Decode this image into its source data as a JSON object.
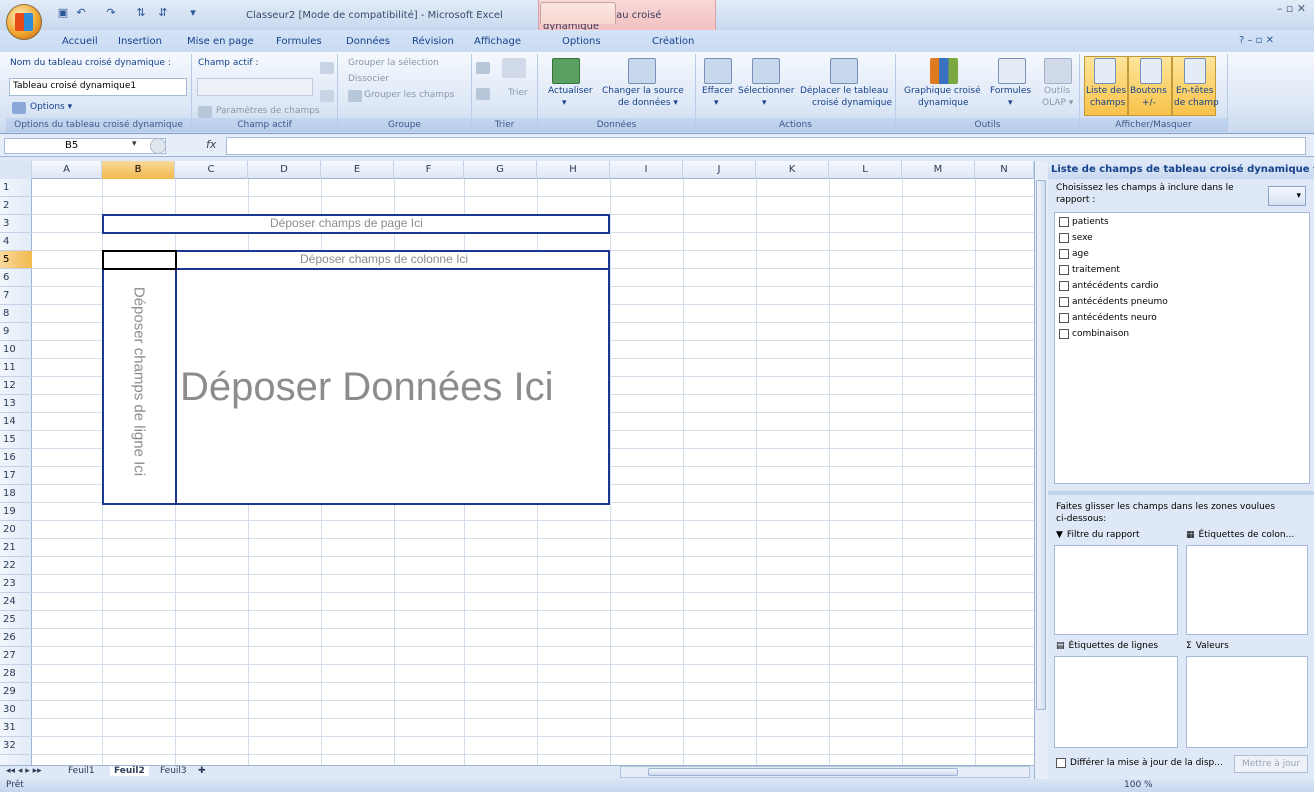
{
  "window": {
    "title": "Classeur2  [Mode de compatibilité] - Microsoft Excel",
    "context_title": "Outils de tableau croisé dynamique",
    "controls": "–  ▫  ✕"
  },
  "tabs": [
    "Accueil",
    "Insertion",
    "Mise en page",
    "Formules",
    "Données",
    "Révision",
    "Affichage",
    "Options",
    "Création"
  ],
  "help": "?  –  ▫  ✕",
  "ribbon": {
    "pivot_name_label": "Nom du tableau croisé dynamique :",
    "pivot_name_value": "Tableau croisé dynamique1",
    "options_btn": "Options ▾",
    "group1": "Options du tableau croisé dynamique",
    "active_field_label": "Champ actif :",
    "field_params": "Paramètres de champs",
    "group2": "Champ actif",
    "group_selection": "Grouper la sélection",
    "ungroup": "Dissocier",
    "group_fields": "Grouper les champs",
    "group3": "Groupe",
    "sort": "Trier",
    "group4": "Trier",
    "refresh": "Actualiser",
    "refresh_arrow": "▾",
    "change_source_1": "Changer la source",
    "change_source_2": "de données ▾",
    "group5": "Données",
    "clear": "Effacer",
    "select": "Sélectionner",
    "move_1": "Déplacer le tableau",
    "move_2": "croisé dynamique",
    "arrow": "▾",
    "group6": "Actions",
    "chart_1": "Graphique croisé",
    "chart_2": "dynamique",
    "formulas": "Formules",
    "olap_1": "Outils",
    "olap_2": "OLAP ▾",
    "group7": "Outils",
    "fieldlist_1": "Liste des",
    "fieldlist_2": "champs",
    "buttons_1": "Boutons",
    "buttons_2": "+/-",
    "headers_1": "En-têtes",
    "headers_2": "de champ",
    "group8": "Afficher/Masquer"
  },
  "formula": {
    "namebox": "B5",
    "fx": "fx",
    "value": ""
  },
  "columns": [
    "A",
    "B",
    "C",
    "D",
    "E",
    "F",
    "G",
    "H",
    "I",
    "J",
    "K",
    "L",
    "M",
    "N"
  ],
  "rows": [
    "1",
    "2",
    "3",
    "4",
    "5",
    "6",
    "7",
    "8",
    "9",
    "10",
    "11",
    "12",
    "13",
    "14",
    "15",
    "16",
    "17",
    "18",
    "19",
    "20",
    "21",
    "22",
    "23",
    "24",
    "25",
    "26",
    "27",
    "28",
    "29",
    "30",
    "31",
    "32"
  ],
  "pivot": {
    "page": "Déposer champs de page Ici",
    "column": "Déposer champs de colonne Ici",
    "row": "Déposer champs de ligne Ici",
    "data": "Déposer Données Ici"
  },
  "sheets": [
    "Feuil1",
    "Feuil2",
    "Feuil3"
  ],
  "status": {
    "left": "Prêt",
    "zoom": "100 %"
  },
  "pane": {
    "title": "Liste de champs de tableau croisé dynamique ▾ ✕",
    "choose_1": "Choisissez les champs à inclure dans le",
    "choose_2": "rapport :",
    "fields": [
      "patients",
      "sexe",
      "age",
      "traitement",
      "antécédents cardio",
      "antécédents pneumo",
      "antécédents neuro",
      "combinaison"
    ],
    "drag_1": "Faites glisser les champs dans les zones voulues",
    "drag_2": "ci-dessous:",
    "report_filter": "Filtre du rapport",
    "col_labels": "Étiquettes de colon...",
    "row_labels": "Étiquettes de lignes",
    "values": "Valeurs",
    "defer": "Différer la mise à jour de la disp...",
    "update": "Mettre à jour"
  }
}
